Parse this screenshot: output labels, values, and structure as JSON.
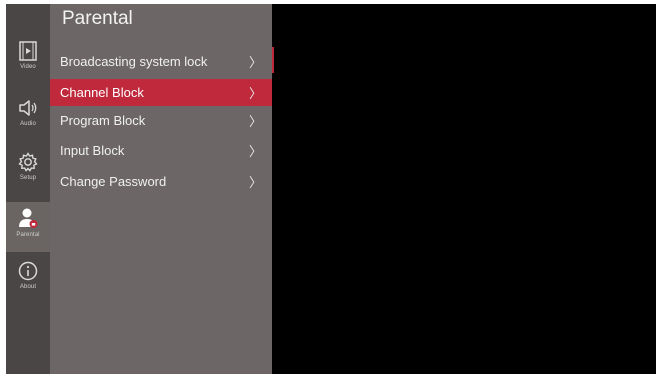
{
  "sidebar": {
    "items": [
      {
        "label": "Video",
        "icon": "video-icon"
      },
      {
        "label": "Audio",
        "icon": "speaker-icon"
      },
      {
        "label": "Setup",
        "icon": "gear-icon"
      },
      {
        "label": "Parental",
        "icon": "parental-user-icon",
        "active": true
      },
      {
        "label": "About",
        "icon": "info-icon"
      }
    ]
  },
  "panel": {
    "title": "Parental",
    "chevron": "〉",
    "items": [
      {
        "label": "Broadcasting system lock"
      },
      {
        "label": "Channel Block",
        "selected": true
      },
      {
        "label": "Program Block"
      },
      {
        "label": "Input Block"
      },
      {
        "label": "Change Password"
      }
    ]
  },
  "colors": {
    "accent": "#c0283c",
    "rail_bg": "#4a4645",
    "panel_bg": "#6c6766"
  }
}
